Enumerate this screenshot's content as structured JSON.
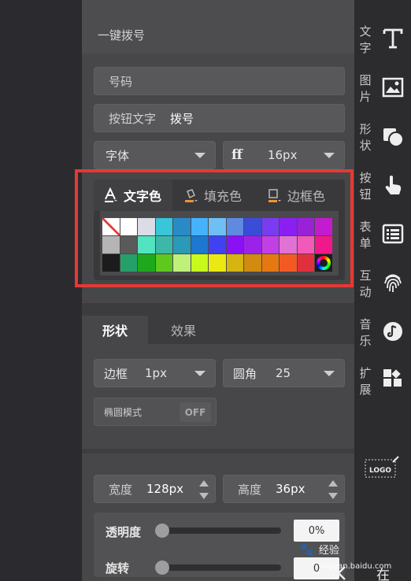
{
  "panel": {
    "title": "一键拨号",
    "phone_placeholder": "号码",
    "button_text_label": "按钮文字",
    "button_text_value": "拨号",
    "font_select": "字体",
    "font_size": "16px"
  },
  "color_tabs": {
    "text_color": "文字色",
    "fill_color": "填充色",
    "border_color": "边框色"
  },
  "swatches": [
    [
      "none",
      "#ffffff",
      "#dcdce6",
      "#38c6d8",
      "#2a8ac8",
      "#45b2fb",
      "#6fbff5",
      "#5f8ae0",
      "#3a4cd8",
      "#7a3cf0",
      "#8b1ff2",
      "#9a21d6",
      "#c31bd0"
    ],
    [
      "#b5b5b5",
      "#5a5a5a",
      "#52e3c0",
      "#3bb8a8",
      "#2a9ab8",
      "#1c78d0",
      "#3e42f2",
      "#8a11f6",
      "#9c22ea",
      "#c040e6",
      "#e072d6",
      "#f15ab8",
      "#f0188a"
    ],
    [
      "#1c1c1c",
      "#26a069",
      "#1ea81e",
      "#5ec81e",
      "#bff07a",
      "#c8fa1e",
      "#eaea12",
      "#d6b412",
      "#d18a12",
      "#e67812",
      "#f25a23",
      "#e0303e",
      "ring"
    ]
  ],
  "style_tabs": {
    "shape": "形状",
    "effect": "效果"
  },
  "border": {
    "label": "边框",
    "value": "1px"
  },
  "radius": {
    "label": "圆角",
    "value": "25"
  },
  "oval_mode": {
    "label": "椭圆模式",
    "toggle": "OFF"
  },
  "width": {
    "label": "宽度",
    "value": "128px"
  },
  "height": {
    "label": "高度",
    "value": "36px"
  },
  "opacity": {
    "label": "透明度",
    "value": "0%",
    "level": 0
  },
  "rotation": {
    "label": "旋转",
    "value": "0",
    "level": 0
  },
  "sidebar": [
    {
      "label": "文字",
      "icon": "text-icon"
    },
    {
      "label": "图片",
      "icon": "image-icon"
    },
    {
      "label": "形状",
      "icon": "shape-icon"
    },
    {
      "label": "按钮",
      "icon": "hand-pointer-icon"
    },
    {
      "label": "表单",
      "icon": "form-list-icon"
    },
    {
      "label": "互动",
      "icon": "fingerprint-icon"
    },
    {
      "label": "音乐",
      "icon": "music-icon"
    },
    {
      "label": "扩展",
      "icon": "extension-icon"
    }
  ],
  "logo_tool": "LOGO",
  "watermark": {
    "text": "经验",
    "url": "jingyan.baidu.com"
  },
  "bottom_char": "在",
  "accent": "#e53935"
}
